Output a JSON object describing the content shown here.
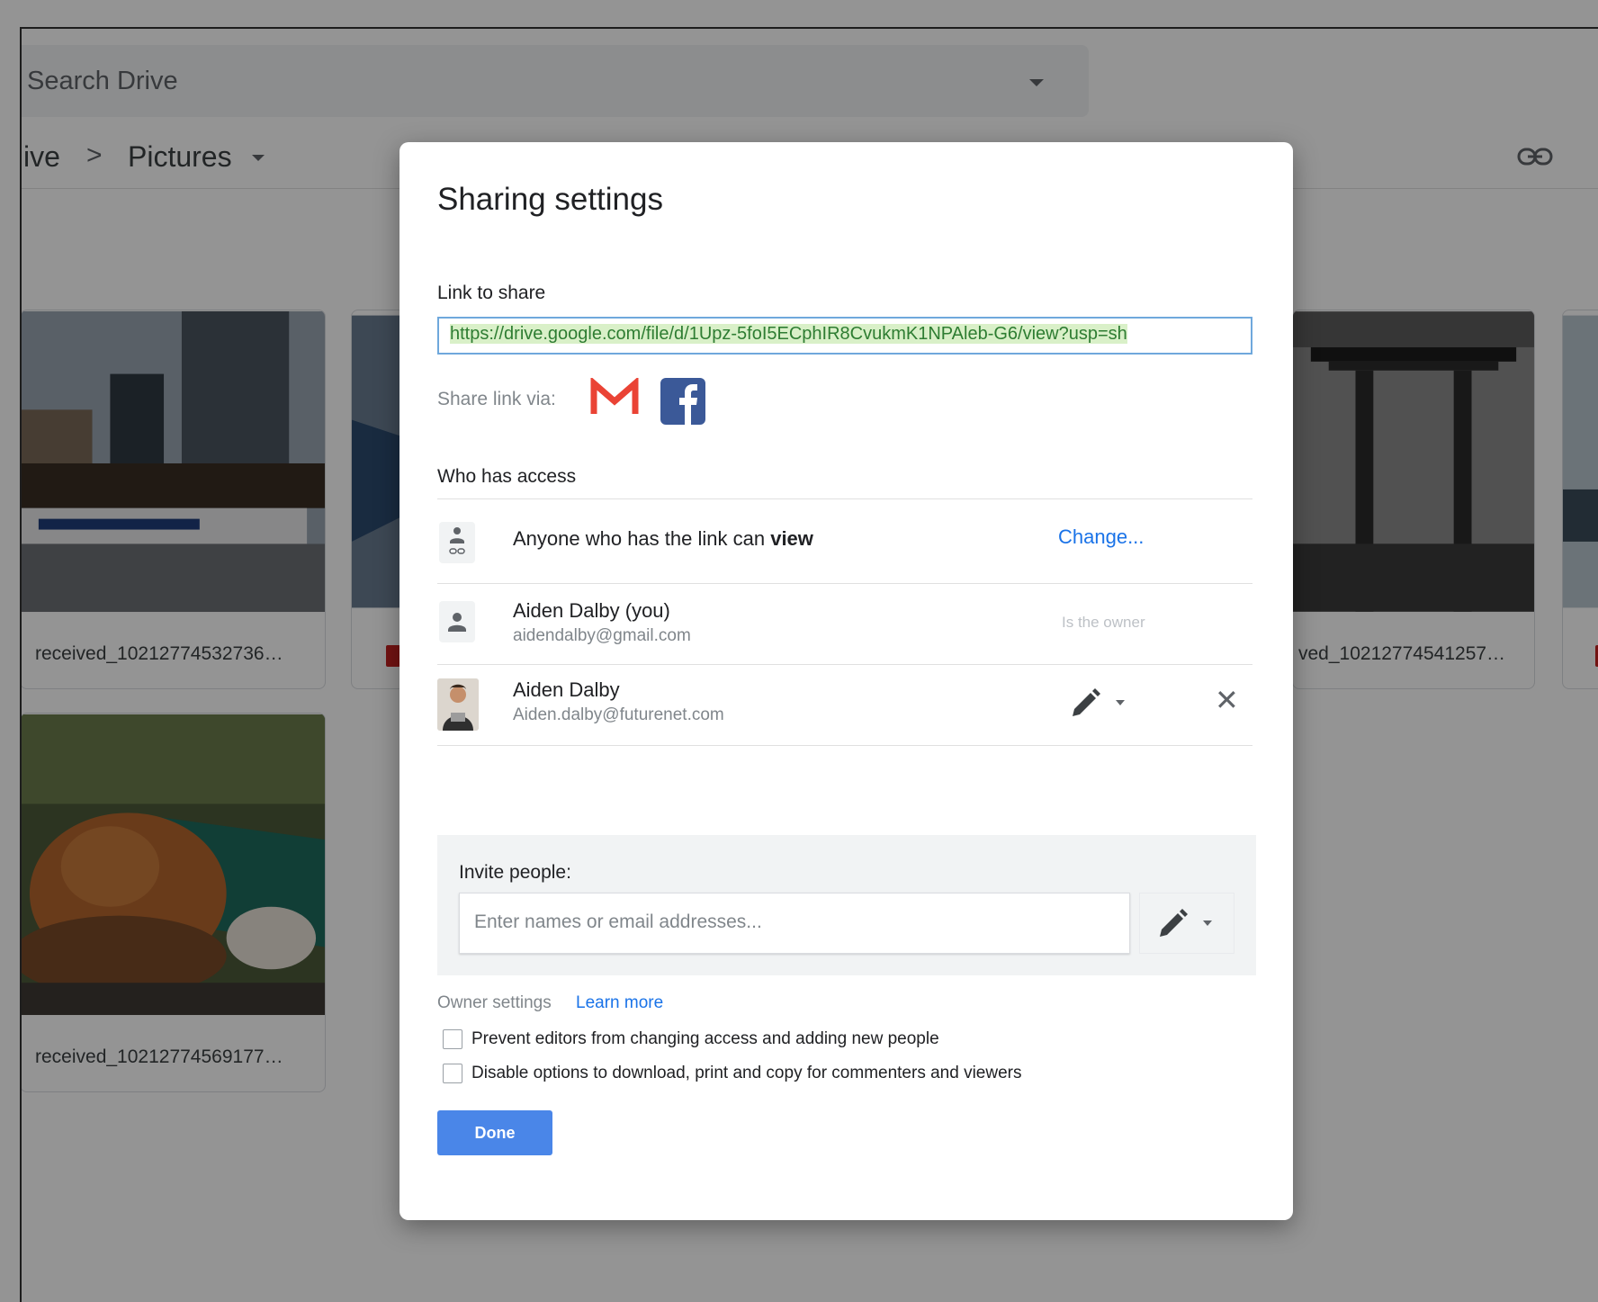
{
  "background": {
    "search": {
      "placeholder": "Search Drive"
    },
    "breadcrumb": {
      "parent": "ive",
      "separator": ">",
      "current": "Pictures"
    },
    "files": [
      {
        "name": "received_10212774532736…"
      },
      {
        "name": "ved_10212774541257…"
      },
      {
        "name": "received_10212774569177…"
      }
    ]
  },
  "dialog": {
    "title": "Sharing settings",
    "link_label": "Link to share",
    "link_url": "https://drive.google.com/file/d/1Upz-5foI5ECphIR8CvukmK1NPAleb-G6/view?usp=sh",
    "share_via_label": "Share link via:",
    "who_has_access_label": "Who has access",
    "link_access": {
      "text_prefix": "Anyone who has the link can",
      "text_bold": "view",
      "change_label": "Change..."
    },
    "people": [
      {
        "name": "Aiden Dalby (you)",
        "email": "aidendalby@gmail.com",
        "role_note": "Is the owner"
      },
      {
        "name": "Aiden Dalby",
        "email": "Aiden.dalby@futurenet.com",
        "remove_label": "✕"
      }
    ],
    "invite": {
      "label": "Invite people:",
      "placeholder": "Enter names or email addresses..."
    },
    "owner_settings": {
      "label": "Owner settings",
      "learn_more": "Learn more",
      "options": [
        {
          "label": "Prevent editors from changing access and adding new people",
          "checked": false
        },
        {
          "label": "Disable options to download, print and copy for commenters and viewers",
          "checked": false
        }
      ]
    },
    "done_label": "Done"
  },
  "colors": {
    "accent": "#1a73e8",
    "done_button": "#4a86e8",
    "gmail_red": "#ea4335",
    "facebook_blue": "#3b5998"
  }
}
